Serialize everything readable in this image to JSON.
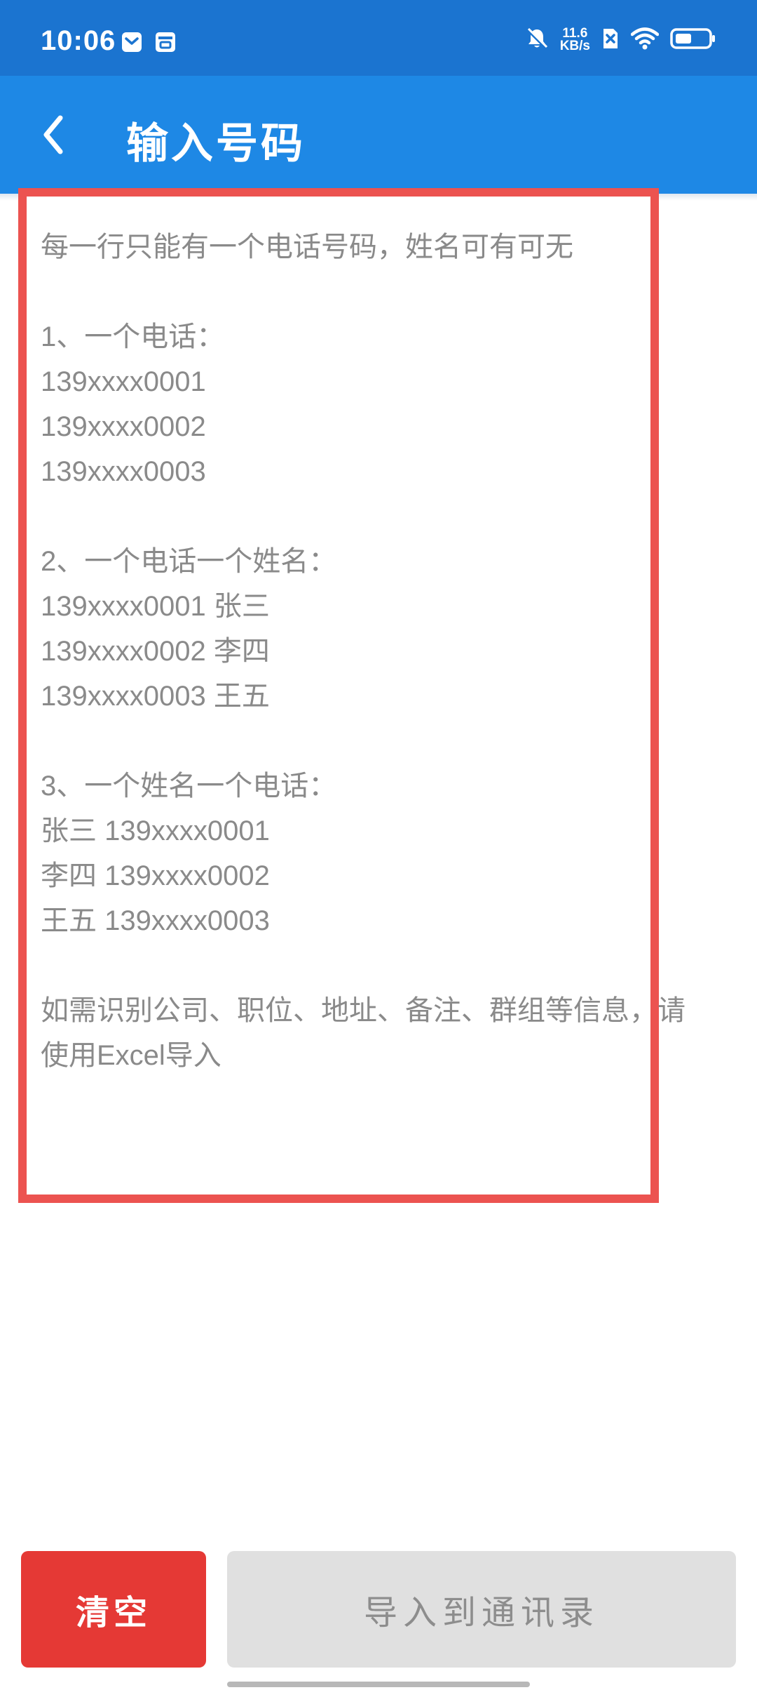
{
  "status_bar": {
    "time": "10:06",
    "net_speed_value": "11.6",
    "net_speed_unit": "KB/s",
    "icons": [
      "mail-icon",
      "calendar-icon",
      "bell-off-icon",
      "sim-x-icon",
      "wifi-icon",
      "battery-icon"
    ],
    "background_color": "#1b74d0"
  },
  "app_bar": {
    "title": "输入号码",
    "back_icon": "chevron-left-icon",
    "background_color": "#1e88e5"
  },
  "input": {
    "border_color": "#ec5350",
    "text_color": "#8a8a8a",
    "lines": [
      "每一行只能有一个电话号码，姓名可有可无",
      "",
      "1、一个电话：",
      "139xxxx0001",
      "139xxxx0002",
      "139xxxx0003",
      "",
      "2、一个电话一个姓名：",
      "139xxxx0001 张三",
      "139xxxx0002 李四",
      "139xxxx0003 王五",
      "",
      "3、一个姓名一个电话：",
      "张三 139xxxx0001",
      "李四 139xxxx0002",
      "王五 139xxxx0003",
      "",
      "如需识别公司、职位、地址、备注、群组等信息，请",
      "使用Excel导入"
    ]
  },
  "buttons": {
    "clear_label": "清空",
    "clear_color": "#e53935",
    "import_label": "导入到通讯录",
    "import_color": "#e0e0e0"
  }
}
